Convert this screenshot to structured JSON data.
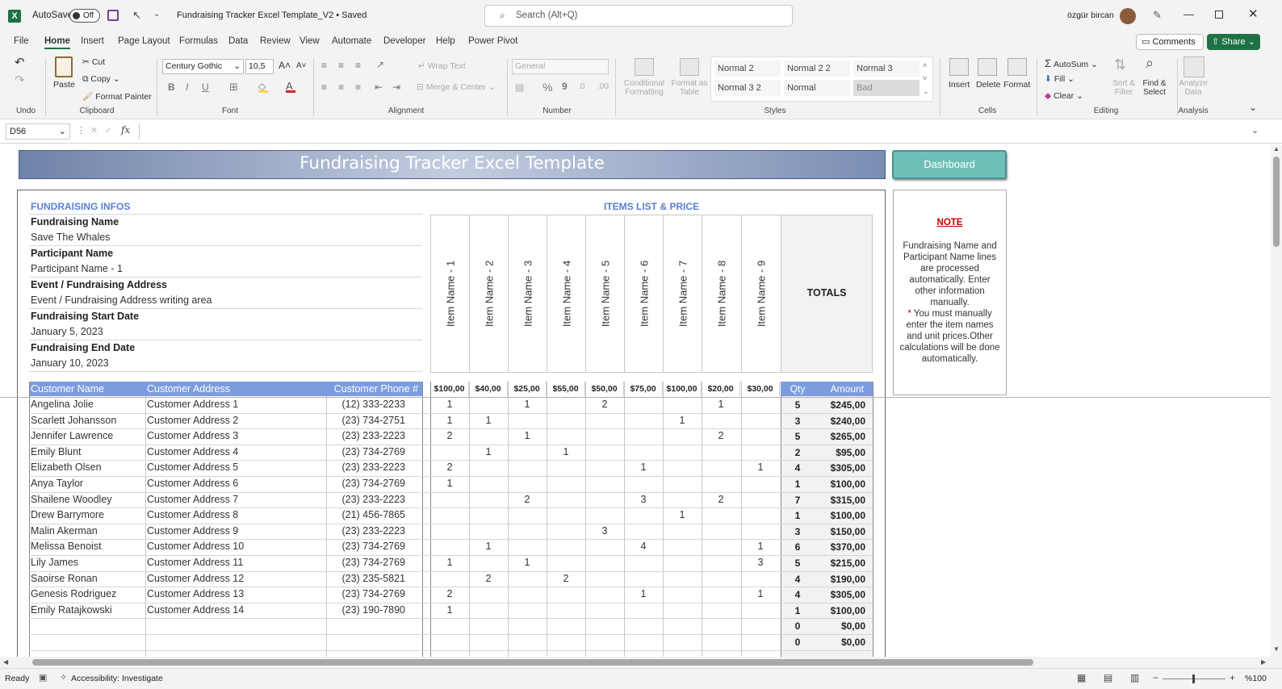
{
  "titlebar": {
    "autosave_label": "AutoSave",
    "autosave_state": "Off",
    "filename": "Fundraising Tracker Excel Template_V2 • Saved",
    "search_placeholder": "Search (Alt+Q)",
    "user": "özgür bircan"
  },
  "menu": [
    "File",
    "Home",
    "Insert",
    "Page Layout",
    "Formulas",
    "Data",
    "Review",
    "View",
    "Automate",
    "Developer",
    "Help",
    "Power Pivot"
  ],
  "menu_right": {
    "comments": "Comments",
    "share": "Share"
  },
  "ribbon": {
    "undo_group": "Undo",
    "clipboard": {
      "paste": "Paste",
      "cut": "Cut",
      "copy": "Copy",
      "format_painter": "Format Painter",
      "group": "Clipboard"
    },
    "font": {
      "name": "Century Gothic",
      "size": "10,5",
      "group": "Font",
      "bold": "B",
      "italic": "I",
      "underline": "U"
    },
    "alignment": {
      "wrap": "Wrap Text",
      "merge": "Merge & Center",
      "group": "Alignment"
    },
    "number": {
      "format": "General",
      "group": "Number",
      "percent": "%",
      "comma": "9"
    },
    "styles": {
      "conditional": "Conditional Formatting",
      "format_table": "Format as Table",
      "cells": [
        "Normal 2",
        "Normal 2 2",
        "Normal 3",
        "Normal 3 2",
        "Normal",
        "Bad"
      ],
      "group": "Styles"
    },
    "cells_group": {
      "insert": "Insert",
      "delete": "Delete",
      "format": "Format",
      "group": "Cells"
    },
    "editing": {
      "autosum": "AutoSum",
      "fill": "Fill",
      "clear": "Clear",
      "sort": "Sort & Filter",
      "find": "Find & Select",
      "group": "Editing"
    },
    "analysis": {
      "analyze": "Analyze Data",
      "group": "Analysis"
    }
  },
  "formula_bar": {
    "name_box": "D56",
    "fx": "fx"
  },
  "sheet": {
    "title": "Fundraising Tracker Excel Template",
    "dashboard": "Dashboard",
    "infos_heading": "FUNDRAISING INFOS",
    "items_heading": "ITEMS LIST & PRICE",
    "fields": [
      {
        "label": "Fundraising Name",
        "value": "Save The Whales"
      },
      {
        "label": "Participant Name",
        "value": "Participant Name - 1"
      },
      {
        "label": "Event / Fundraising Address",
        "value": "Event / Fundraising Address writing area"
      },
      {
        "label": "Fundraising Start Date",
        "value": "January 5, 2023"
      },
      {
        "label": "Fundraising End Date",
        "value": "January 10, 2023"
      }
    ],
    "items": [
      "Item Name - 1",
      "Item Name - 2",
      "Item Name - 3",
      "Item Name - 4",
      "Item Name - 5",
      "Item Name - 6",
      "Item Name - 7",
      "Item Name - 8",
      "Item Name - 9"
    ],
    "prices": [
      "$100,00",
      "$40,00",
      "$25,00",
      "$55,00",
      "$50,00",
      "$75,00",
      "$100,00",
      "$20,00",
      "$30,00"
    ],
    "totals_label": "TOTALS",
    "headers": {
      "name": "Customer Name",
      "address": "Customer Address",
      "phone": "Customer Phone #",
      "qty": "Qty",
      "amount": "Amount"
    },
    "note_title": "NOTE",
    "note_text_1": "Fundraising Name and Participant Name lines are processed automatically. Enter other information manually.",
    "note_star": "*",
    "note_text_2": " You must manually enter the item names and unit prices.Other calculations will be done automatically.",
    "rows": [
      {
        "name": "Angelina Jolie",
        "address": "Customer Address 1",
        "phone": "(12) 333-2233",
        "q": [
          "1",
          "",
          "1",
          "",
          "2",
          "",
          "",
          "1",
          ""
        ],
        "qty": "5",
        "amount": "$245,00"
      },
      {
        "name": "Scarlett Johansson",
        "address": "Customer Address 2",
        "phone": "(23) 734-2751",
        "q": [
          "1",
          "1",
          "",
          "",
          "",
          "",
          "1",
          "",
          ""
        ],
        "qty": "3",
        "amount": "$240,00"
      },
      {
        "name": "Jennifer Lawrence",
        "address": "Customer Address 3",
        "phone": "(23) 233-2223",
        "q": [
          "2",
          "",
          "1",
          "",
          "",
          "",
          "",
          "2",
          ""
        ],
        "qty": "5",
        "amount": "$265,00"
      },
      {
        "name": "Emily Blunt",
        "address": "Customer Address 4",
        "phone": "(23) 734-2769",
        "q": [
          "",
          "1",
          "",
          "1",
          "",
          "",
          "",
          "",
          ""
        ],
        "qty": "2",
        "amount": "$95,00"
      },
      {
        "name": "Elizabeth Olsen",
        "address": "Customer Address 5",
        "phone": "(23) 233-2223",
        "q": [
          "2",
          "",
          "",
          "",
          "",
          "1",
          "",
          "",
          "1"
        ],
        "qty": "4",
        "amount": "$305,00"
      },
      {
        "name": "Anya Taylor",
        "address": "Customer Address 6",
        "phone": "(23) 734-2769",
        "q": [
          "1",
          "",
          "",
          "",
          "",
          "",
          "",
          "",
          ""
        ],
        "qty": "1",
        "amount": "$100,00"
      },
      {
        "name": "Shailene Woodley",
        "address": "Customer Address 7",
        "phone": "(23) 233-2223",
        "q": [
          "",
          "",
          "2",
          "",
          "",
          "3",
          "",
          "2",
          ""
        ],
        "qty": "7",
        "amount": "$315,00"
      },
      {
        "name": "Drew Barrymore",
        "address": "Customer Address 8",
        "phone": "(21) 456-7865",
        "q": [
          "",
          "",
          "",
          "",
          "",
          "",
          "1",
          "",
          ""
        ],
        "qty": "1",
        "amount": "$100,00"
      },
      {
        "name": "Malin Akerman",
        "address": "Customer Address 9",
        "phone": "(23) 233-2223",
        "q": [
          "",
          "",
          "",
          "",
          "3",
          "",
          "",
          "",
          ""
        ],
        "qty": "3",
        "amount": "$150,00"
      },
      {
        "name": "Melissa Benoist",
        "address": "Customer Address 10",
        "phone": "(23) 734-2769",
        "q": [
          "",
          "1",
          "",
          "",
          "",
          "4",
          "",
          "",
          "1"
        ],
        "qty": "6",
        "amount": "$370,00"
      },
      {
        "name": "Lily James",
        "address": "Customer Address 11",
        "phone": "(23) 734-2769",
        "q": [
          "1",
          "",
          "1",
          "",
          "",
          "",
          "",
          "",
          "3"
        ],
        "qty": "5",
        "amount": "$215,00"
      },
      {
        "name": "Saoirse Ronan",
        "address": "Customer Address 12",
        "phone": "(23) 235-5821",
        "q": [
          "",
          "2",
          "",
          "2",
          "",
          "",
          "",
          "",
          ""
        ],
        "qty": "4",
        "amount": "$190,00"
      },
      {
        "name": "Genesis Rodriguez",
        "address": "Customer Address 13",
        "phone": "(23) 734-2769",
        "q": [
          "2",
          "",
          "",
          "",
          "",
          "1",
          "",
          "",
          "1"
        ],
        "qty": "4",
        "amount": "$305,00"
      },
      {
        "name": "Emily Ratajkowski",
        "address": "Customer Address 14",
        "phone": "(23) 190-7890",
        "q": [
          "1",
          "",
          "",
          "",
          "",
          "",
          "",
          "",
          ""
        ],
        "qty": "1",
        "amount": "$100,00"
      },
      {
        "name": "",
        "address": "",
        "phone": "",
        "q": [
          "",
          "",
          "",
          "",
          "",
          "",
          "",
          "",
          ""
        ],
        "qty": "0",
        "amount": "$0,00"
      },
      {
        "name": "",
        "address": "",
        "phone": "",
        "q": [
          "",
          "",
          "",
          "",
          "",
          "",
          "",
          "",
          ""
        ],
        "qty": "0",
        "amount": "$0,00"
      }
    ]
  },
  "status": {
    "ready": "Ready",
    "accessibility": "Accessibility: Investigate",
    "zoom": "%100"
  },
  "colors": {
    "excel_green": "#1e7145",
    "header_blue": "#7b9de0",
    "heading_blue": "#5a7fd6",
    "dashboard_teal": "#6fbfb9",
    "note_red": "#c00000"
  }
}
